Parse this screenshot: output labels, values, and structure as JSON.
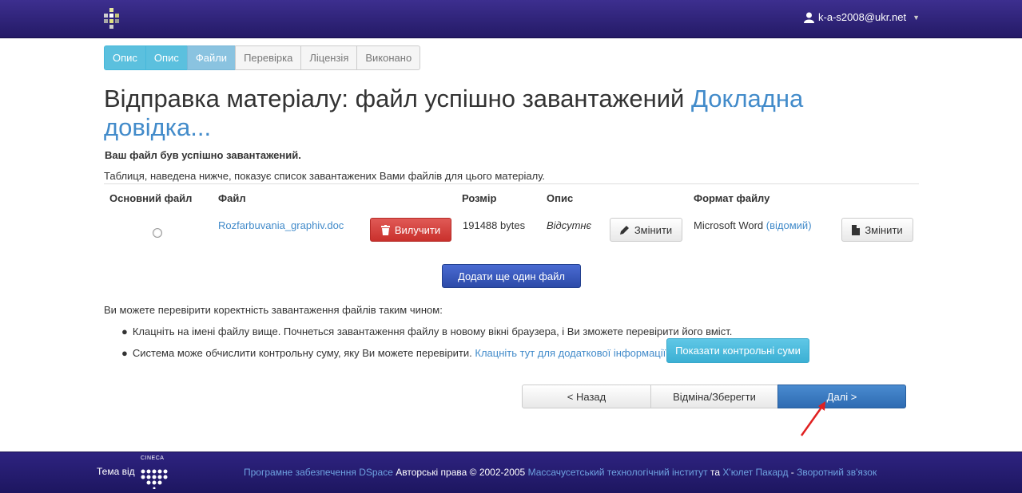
{
  "header": {
    "user": "k-a-s2008@ukr.net"
  },
  "progress": [
    {
      "label": "Опис",
      "state": "done"
    },
    {
      "label": "Опис",
      "state": "done"
    },
    {
      "label": "Файли",
      "state": "current"
    },
    {
      "label": "Перевірка",
      "state": "todo"
    },
    {
      "label": "Ліцензія",
      "state": "todo"
    },
    {
      "label": "Виконано",
      "state": "todo"
    }
  ],
  "title": {
    "text": "Відправка матеріалу: файл успішно завантажений",
    "help_link": "Докладна довідка..."
  },
  "success_text": "Ваш файл був успішно завантажений.",
  "table_desc": "Таблиця, наведена нижче, показує список завантажених Вами файлів для цього матеріалу.",
  "table": {
    "headers": {
      "primary": "Основний файл",
      "file": "Файл",
      "size": "Розмір",
      "description": "Опис",
      "format": "Формат файлу"
    },
    "row": {
      "filename": "Rozfarbuvania_graphiv.doc",
      "remove_label": "Вилучити",
      "size": "191488 bytes",
      "description": "Відсутнє",
      "edit_desc_label": "Змінити",
      "format": "Microsoft Word",
      "format_status": "(відомий)",
      "edit_format_label": "Змінити"
    }
  },
  "add_file_label": "Додати ще один файл",
  "verify": {
    "intro": "Ви можете перевірити коректність завантаження файлів таким чином:",
    "bullet1": "Клацніть на імені файлу вище. Почнеться завантаження файлу в новому вікні браузера, і Ви зможете перевірити його вміст.",
    "bullet2": "Система може обчислити контрольну суму, яку Ви можете перевірити.",
    "bullet2_link": "Клацніть тут для додаткової інформації.",
    "checksum_button": "Показати контрольні суми"
  },
  "nav": {
    "back": "< Назад",
    "save": "Відміна/Зберегти",
    "next": "Далі >"
  },
  "footer": {
    "theme_by": "Тема від",
    "logo_text": "CINECA",
    "software_link": "Програмне забезпечення DSpace",
    "copyright": "Авторські права © 2002-2005",
    "mit_link": "Массачусетський технологічний інститут",
    "and": "та",
    "hp_link": "Х'юлет Пакард",
    "dash": "-",
    "feedback_link": "Зворотний зв'язок"
  },
  "colors": {
    "navbar": "#2e2380",
    "primary_link": "#428bca",
    "danger": "#d9534f",
    "info": "#5bc0de"
  }
}
